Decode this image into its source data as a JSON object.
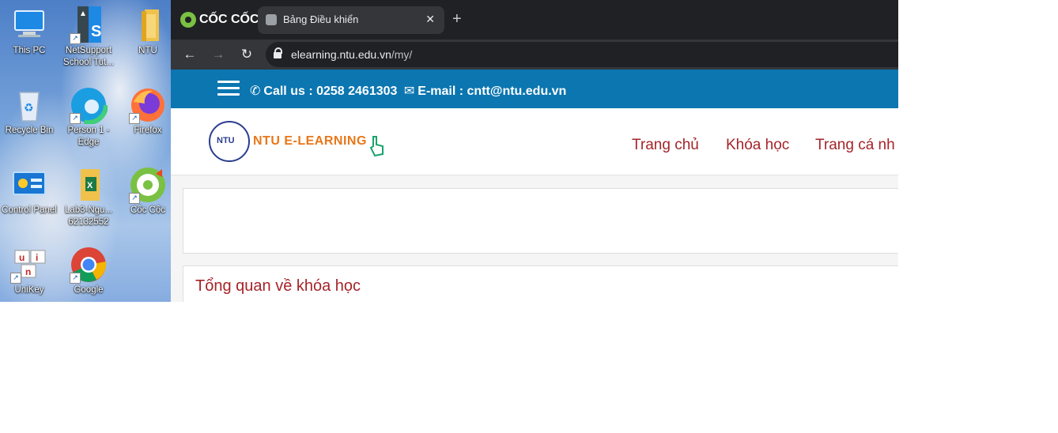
{
  "desktop": {
    "icons": [
      {
        "label": "This PC",
        "icon": "computer-icon"
      },
      {
        "label": "NetSupport School Tut...",
        "icon": "netsupport-icon"
      },
      {
        "label": "NTU",
        "icon": "folder-icon"
      },
      {
        "label": "Recycle Bin",
        "icon": "recycle-bin-icon"
      },
      {
        "label": "Person 1 - Edge",
        "icon": "edge-icon"
      },
      {
        "label": "Firefox",
        "icon": "firefox-icon"
      },
      {
        "label": "Control Panel",
        "icon": "control-panel-icon"
      },
      {
        "label": "Lab3-Ngu... 62132552",
        "icon": "excel-folder-icon"
      },
      {
        "label": "Cốc Cốc",
        "icon": "coccoc-icon"
      },
      {
        "label": "UniKey",
        "icon": "unikey-icon"
      },
      {
        "label": "Google",
        "icon": "chrome-icon"
      }
    ]
  },
  "browser": {
    "brand": "CỐC CỐC",
    "tab": {
      "title": "Bảng Điều khiển",
      "close": "✕"
    },
    "new_tab": "+",
    "nav": {
      "back": "←",
      "forward": "→",
      "reload": "↻"
    },
    "address": {
      "host": "elearning.ntu.edu.vn",
      "path": "/my/"
    }
  },
  "site": {
    "contact": {
      "phone_icon": "phone-icon",
      "phone": "Call us : 0258 2461303",
      "email_icon": "envelope-icon",
      "email": "E-mail : cntt@ntu.edu.vn"
    },
    "logo": {
      "seal": "NTU",
      "name": "NTU E-LEARNING"
    },
    "menu": [
      "Trang chủ",
      "Khóa học",
      "Trang cá nh"
    ],
    "section_title": "Tổng quan về khóa học"
  },
  "colors": {
    "brand_blue": "#0b76b0",
    "menu_red": "#a5242a",
    "logo_orange": "#e8771a",
    "chrome_dark": "#202124"
  }
}
